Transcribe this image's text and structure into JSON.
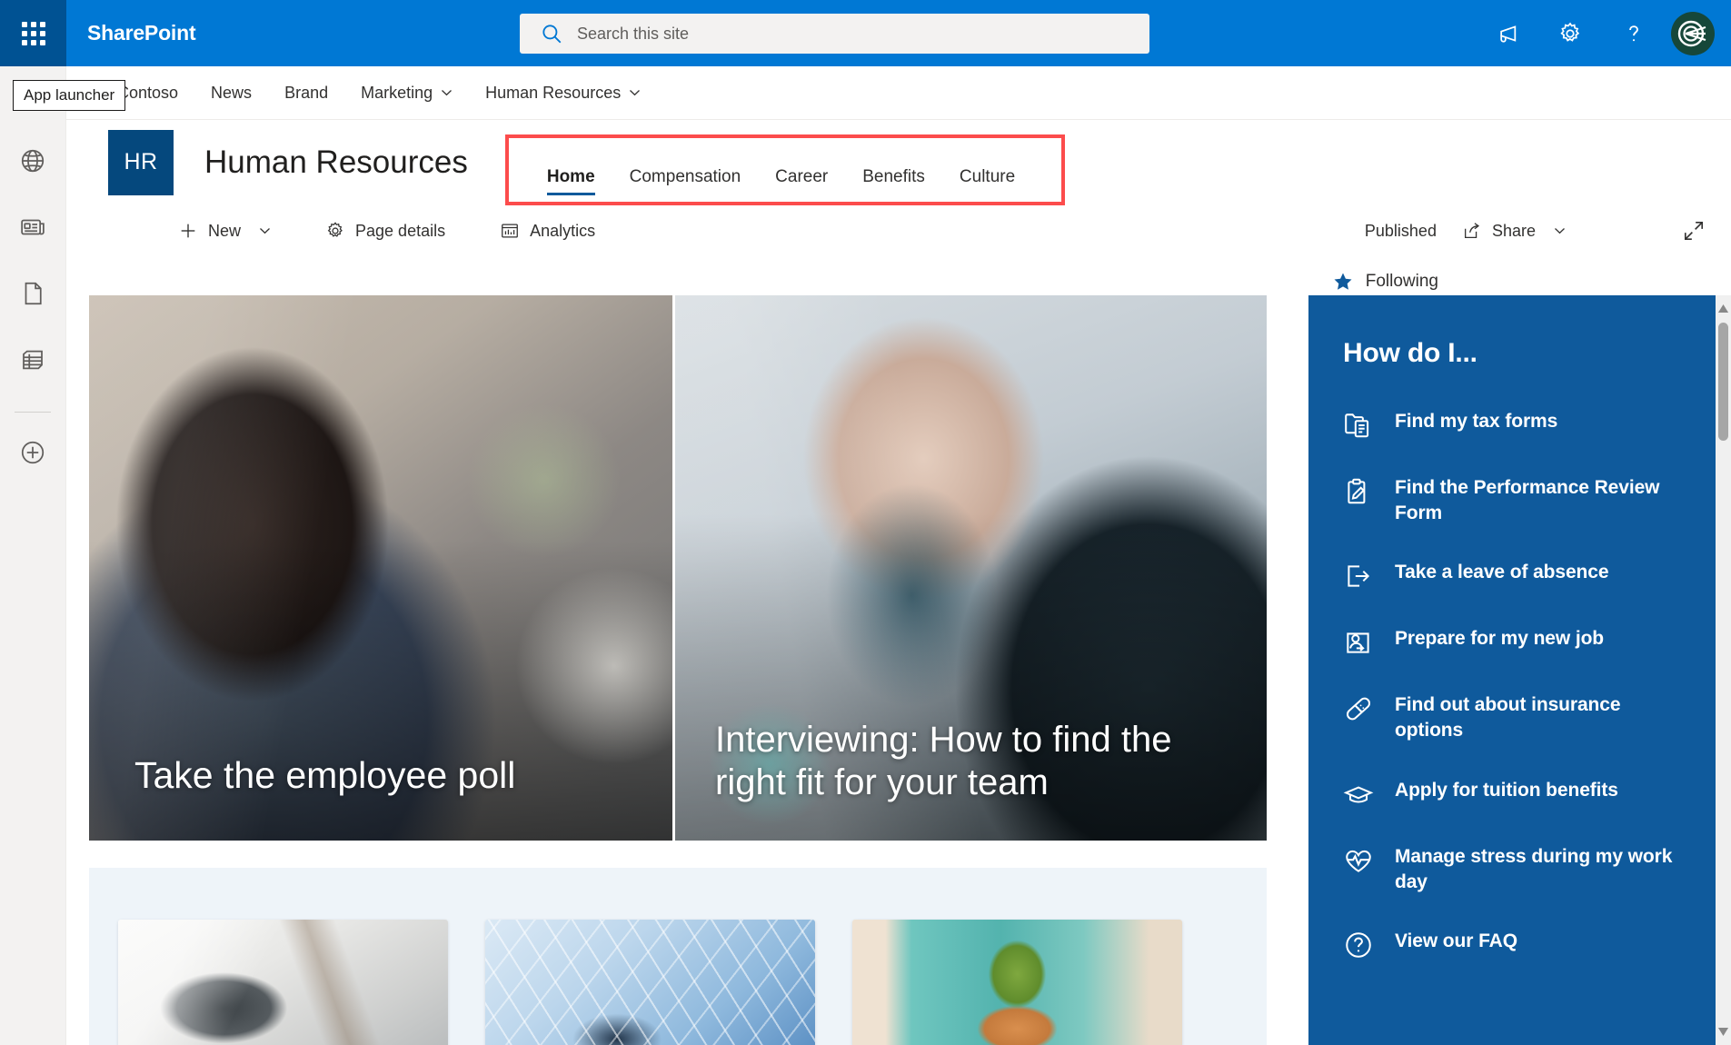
{
  "suite": {
    "app_launcher_label": "App launcher",
    "brand": "SharePoint",
    "search_placeholder": "Search this site",
    "search_value": "",
    "actions": [
      {
        "name": "megaphone-icon",
        "label": "Announcements"
      },
      {
        "name": "gear-icon",
        "label": "Settings"
      },
      {
        "name": "help-icon",
        "label": "Help"
      }
    ],
    "avatar_label": "Account manager"
  },
  "hub_nav": {
    "items": [
      {
        "label": "Contoso",
        "has_chevron": false
      },
      {
        "label": "News",
        "has_chevron": false
      },
      {
        "label": "Brand",
        "has_chevron": false
      },
      {
        "label": "Marketing",
        "has_chevron": true
      },
      {
        "label": "Human Resources",
        "has_chevron": true
      }
    ]
  },
  "rail": {
    "items": [
      {
        "name": "sidebar-globe",
        "icon": "globe-icon"
      },
      {
        "name": "sidebar-news",
        "icon": "news-icon"
      },
      {
        "name": "sidebar-page",
        "icon": "page-icon"
      },
      {
        "name": "sidebar-list",
        "icon": "list-icon"
      },
      {
        "name": "sidebar-create",
        "icon": "plus-circle-icon"
      }
    ]
  },
  "site": {
    "logo_text": "HR",
    "title": "Human Resources",
    "nav": [
      {
        "label": "Home",
        "active": true
      },
      {
        "label": "Compensation",
        "active": false
      },
      {
        "label": "Career",
        "active": false
      },
      {
        "label": "Benefits",
        "active": false
      },
      {
        "label": "Culture",
        "active": false
      }
    ],
    "following_label": "Following"
  },
  "command_bar": {
    "new_label": "New",
    "page_details_label": "Page details",
    "analytics_label": "Analytics",
    "status_label": "Published",
    "share_label": "Share"
  },
  "hero": {
    "tiles": [
      {
        "title": "Take the employee poll"
      },
      {
        "title": "Interviewing: How to find the right fit for your team"
      }
    ]
  },
  "news_cards": [
    {
      "name": "news-card-calculator"
    },
    {
      "name": "news-card-abstract"
    },
    {
      "name": "news-card-plant"
    }
  ],
  "how_do_i": {
    "title": "How do I...",
    "items": [
      {
        "label": "Find my tax forms",
        "icon": "folder-document-icon"
      },
      {
        "label": "Find the Performance Review Form",
        "icon": "clipboard-edit-icon"
      },
      {
        "label": "Take a leave of absence",
        "icon": "sign-out-icon"
      },
      {
        "label": "Prepare for my new job",
        "icon": "person-frame-icon"
      },
      {
        "label": "Find out about insurance options",
        "icon": "bandage-icon"
      },
      {
        "label": "Apply for tuition benefits",
        "icon": "graduation-cap-icon"
      },
      {
        "label": "Manage stress during my work day",
        "icon": "heart-pulse-icon"
      },
      {
        "label": "View our FAQ",
        "icon": "question-icon"
      }
    ]
  },
  "colors": {
    "suite_bar": "#0078d4",
    "waffle": "#005293",
    "site_logo": "#05487d",
    "panel": "#0f5a9c",
    "accent_underline": "#0f5a9c",
    "annotation": "#fc4c4c",
    "news_strip": "#eef4f9",
    "rail": "#f3f2f1"
  }
}
